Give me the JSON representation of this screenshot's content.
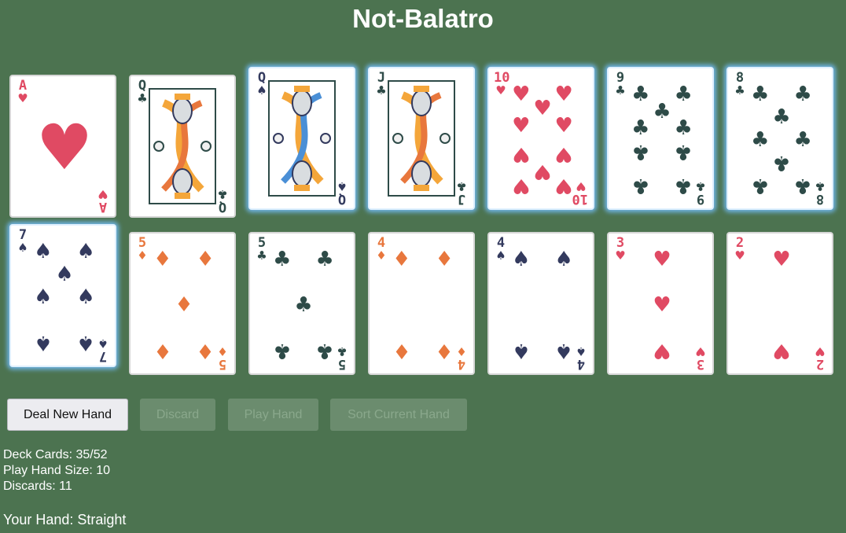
{
  "app": {
    "title": "Not-Balatro"
  },
  "colors": {
    "background": "#4c7350",
    "hearts": "#e04a63",
    "diamonds": "#e8773d",
    "clubs": "#2e4b48",
    "spades": "#333a5e",
    "selection_glow": "#6fb4e6"
  },
  "hand": [
    {
      "rank": "A",
      "suit": "♥",
      "suit_name": "hearts",
      "selected": false
    },
    {
      "rank": "Q",
      "suit": "♣",
      "suit_name": "clubs",
      "selected": false
    },
    {
      "rank": "Q",
      "suit": "♠",
      "suit_name": "spades",
      "selected": true
    },
    {
      "rank": "J",
      "suit": "♣",
      "suit_name": "clubs",
      "selected": true
    },
    {
      "rank": "10",
      "suit": "♥",
      "suit_name": "hearts",
      "selected": true
    },
    {
      "rank": "9",
      "suit": "♣",
      "suit_name": "clubs",
      "selected": true
    },
    {
      "rank": "8",
      "suit": "♣",
      "suit_name": "clubs",
      "selected": true
    },
    {
      "rank": "7",
      "suit": "♠",
      "suit_name": "spades",
      "selected": true
    },
    {
      "rank": "5",
      "suit": "♦",
      "suit_name": "diamonds",
      "selected": false
    },
    {
      "rank": "5",
      "suit": "♣",
      "suit_name": "clubs",
      "selected": false
    },
    {
      "rank": "4",
      "suit": "♦",
      "suit_name": "diamonds",
      "selected": false
    },
    {
      "rank": "4",
      "suit": "♠",
      "suit_name": "spades",
      "selected": false
    },
    {
      "rank": "3",
      "suit": "♥",
      "suit_name": "hearts",
      "selected": false
    },
    {
      "rank": "2",
      "suit": "♥",
      "suit_name": "hearts",
      "selected": false
    }
  ],
  "buttons": {
    "deal": "Deal New Hand",
    "discard": "Discard",
    "play": "Play Hand",
    "sort": "Sort Current Hand"
  },
  "stats": {
    "deck": "Deck Cards: 35/52",
    "hand_size": "Play Hand Size: 10",
    "discards": "Discards: 11"
  },
  "result": "Your Hand: Straight"
}
